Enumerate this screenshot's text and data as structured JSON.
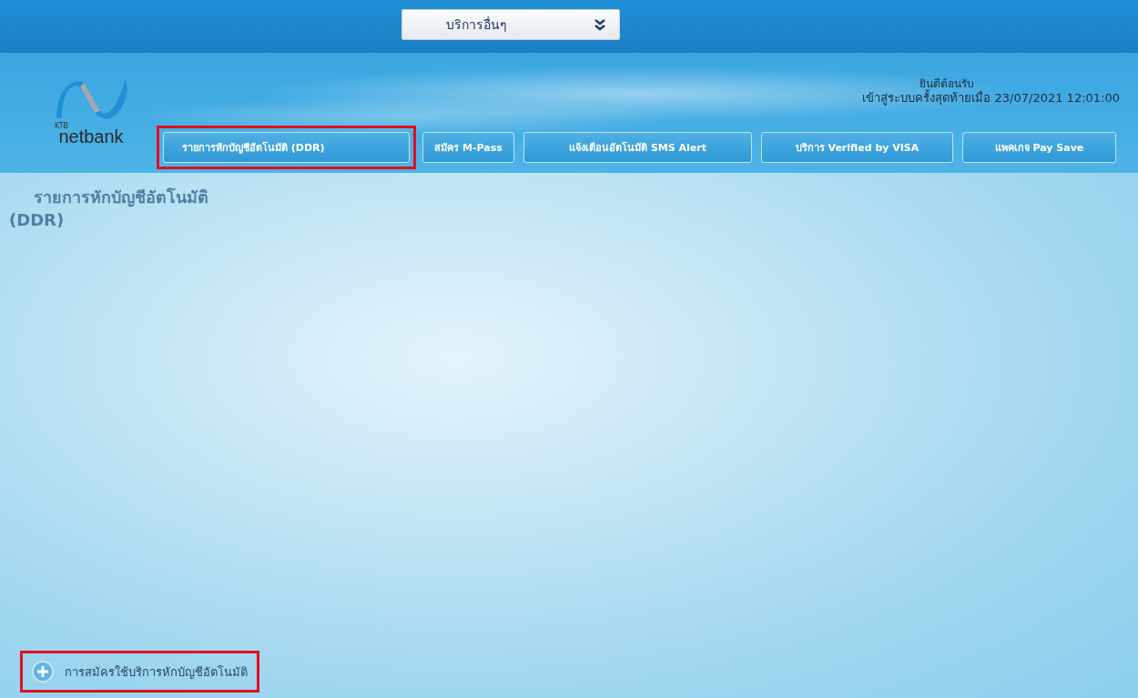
{
  "top_bar": {
    "dropdown": {
      "value": "บริการอื่นๆ"
    }
  },
  "header": {
    "logo_text": "netbank",
    "logo_small": "KTB",
    "welcome": "ยินดีต้อนรับ",
    "last_login": "เข้าสู่ระบบครั้งสุดท้ายเมื่อ 23/07/2021 12:01:00"
  },
  "tabs": [
    {
      "label": "รายการหักบัญชีอัตโนมัติ (DDR)",
      "highlighted": true
    },
    {
      "label": "สมัคร M-Pass",
      "highlighted": false
    },
    {
      "label": "แจ้งเตือนอัตโนมัติ SMS Alert",
      "highlighted": false
    },
    {
      "label": "บริการ Verified by VISA",
      "highlighted": false
    },
    {
      "label": "แพคเกจ Pay Save",
      "highlighted": false
    }
  ],
  "page_title": [
    "รายการหักบัญชีอัตโนมัติ",
    "(DDR)"
  ],
  "actions": [
    {
      "label": "การสมัครใช้บริการหักบัญชีอัตโนมัติ",
      "highlighted": true
    }
  ]
}
